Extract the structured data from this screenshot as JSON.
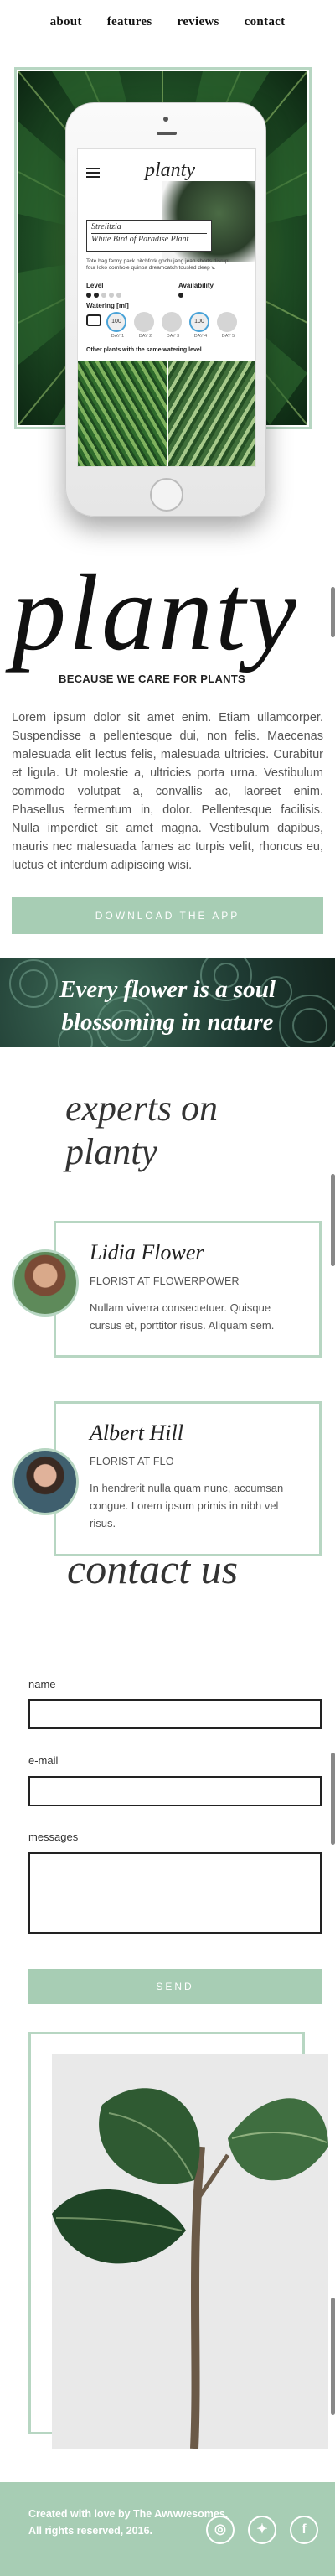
{
  "nav": {
    "items": [
      {
        "label": "about"
      },
      {
        "label": "features"
      },
      {
        "label": "reviews"
      },
      {
        "label": "contact"
      }
    ]
  },
  "app_screen": {
    "logo": "planty",
    "plant_name": "Strelitzia",
    "plant_subtitle": "White Bird of Paradise Plant",
    "description": "Tote bag fanny pack pitchfork gochujang jean shorts disrupt four loko cornhole quinoa dreamcatch tousled deep v.",
    "level_label": "Level",
    "availability_label": "Availability",
    "watering_label": "Watering [ml]",
    "days": [
      {
        "amount": "100",
        "label": "DAY 1"
      },
      {
        "amount": "",
        "label": "DAY 2"
      },
      {
        "amount": "",
        "label": "DAY 3"
      },
      {
        "amount": "100",
        "label": "DAY 4"
      },
      {
        "amount": "",
        "label": "DAY 5"
      }
    ],
    "other_plants_label": "Other plants with the same watering level"
  },
  "hero": {
    "title": "planty",
    "tagline": "BECAUSE WE CARE FOR PLANTS",
    "body": "Lorem ipsum dolor sit amet enim. Etiam ullamcorper. Suspendisse a pellentesque dui, non felis. Maecenas malesuada elit lectus felis, malesuada ultricies. Curabitur et ligula. Ut molestie a, ultricies porta urna. Vestibulum commodo volutpat a, convallis ac, laoreet enim. Phasellus fermentum in, dolor. Pellentesque facilisis. Nulla imperdiet sit amet magna. Vestibulum dapibus, mauris nec malesuada fames ac turpis velit, rhoncus eu, luctus et interdum adipiscing wisi.",
    "download_label": "DOWNLOAD THE APP"
  },
  "banner": {
    "line1": "Every flower is a soul",
    "line2": "blossoming in nature"
  },
  "experts": {
    "title_line1": "experts on",
    "title_line2": "planty",
    "people": [
      {
        "name": "Lidia Flower",
        "role": "FLORIST AT FLOWERPOWER",
        "bio": "Nullam viverra consectetuer. Quisque cursus et, porttitor risus. Aliquam sem."
      },
      {
        "name": "Albert Hill",
        "role": "FLORIST AT FLO",
        "bio": "In hendrerit nulla quam nunc, accumsan congue. Lorem ipsum primis in nibh vel risus."
      }
    ]
  },
  "contact": {
    "title": "contact us",
    "name_label": "name",
    "email_label": "e-mail",
    "messages_label": "messages",
    "send_label": "SEND"
  },
  "footer": {
    "line1": "Created with love by The Awwwesomes.",
    "line2": "All rights reserved, 2016.",
    "social": [
      {
        "icon": "instagram-icon",
        "glyph": "◎"
      },
      {
        "icon": "twitter-icon",
        "glyph": "✦"
      },
      {
        "icon": "facebook-icon",
        "glyph": "f"
      }
    ]
  },
  "colors": {
    "accent": "#a7cdb4",
    "frame": "#b7d6c2",
    "text": "#444444"
  }
}
